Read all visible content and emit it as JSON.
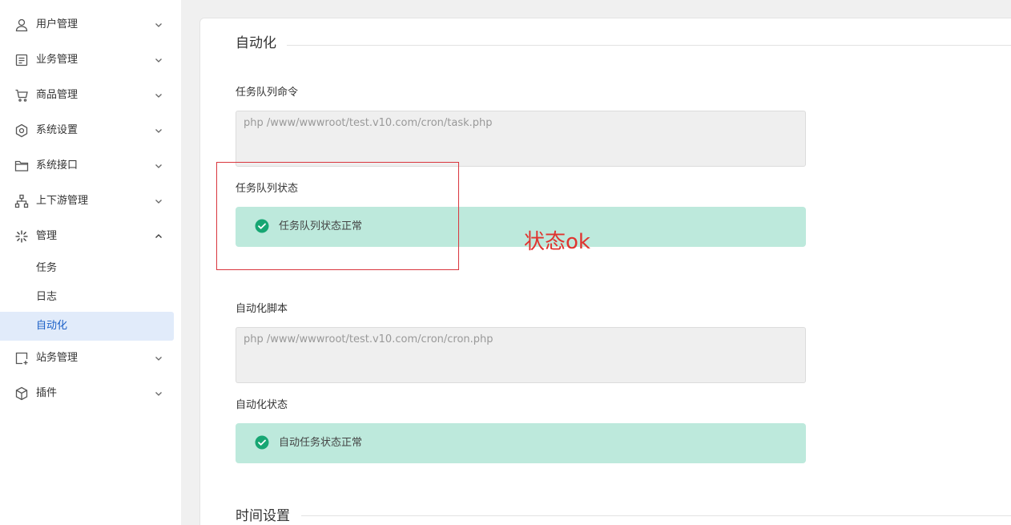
{
  "sidebar": {
    "items": [
      {
        "label": "用户管理",
        "icon": "user-icon"
      },
      {
        "label": "业务管理",
        "icon": "document-list-icon"
      },
      {
        "label": "商品管理",
        "icon": "cart-icon"
      },
      {
        "label": "系统设置",
        "icon": "settings-hexagon-icon"
      },
      {
        "label": "系统接口",
        "icon": "folder-icon"
      },
      {
        "label": "上下游管理",
        "icon": "sitemap-icon"
      },
      {
        "label": "管理",
        "icon": "sparkle-icon",
        "expanded": true
      },
      {
        "label": "站务管理",
        "icon": "station-add-icon"
      },
      {
        "label": "插件",
        "icon": "cube-icon"
      }
    ],
    "sub_items": [
      {
        "label": "任务"
      },
      {
        "label": "日志"
      },
      {
        "label": "自动化",
        "active": true
      }
    ]
  },
  "main": {
    "section_auto": "自动化",
    "queue_cmd_label": "任务队列命令",
    "queue_cmd_value": "php /www/wwwroot/test.v10.com/cron/task.php",
    "queue_status_label": "任务队列状态",
    "queue_status_text": "任务队列状态正常",
    "script_label": "自动化脚本",
    "script_value": "php /www/wwwroot/test.v10.com/cron/cron.php",
    "auto_status_label": "自动化状态",
    "auto_status_text": "自动任务状态正常",
    "section_time": "时间设置"
  },
  "annotation": {
    "text": "状态ok",
    "color": "#e0342f"
  },
  "colors": {
    "active_bg": "#e1ebfa",
    "active_text": "#1a5fc7",
    "status_bg": "#bde9dc",
    "status_check": "#17a673"
  }
}
